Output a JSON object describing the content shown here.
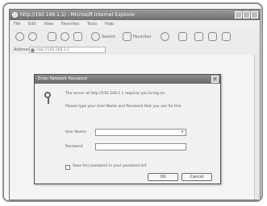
{
  "browser": {
    "title": "http://192.168.1.1/ - Microsoft Internet Explorer",
    "menu": [
      "File",
      "Edit",
      "View",
      "Favorites",
      "Tools",
      "Help"
    ],
    "toolbar": {
      "search_label": "Search",
      "favorites_label": "Favorites"
    },
    "address": {
      "label": "Address",
      "value": "http://192.168.1.1"
    }
  },
  "dialog": {
    "title": "Enter Network Password",
    "prompt": "The server at http://192.168.1.1 requires you to log on.",
    "instruction": "Please type your User Name and Password that you use for this.",
    "username_label": "User Name:",
    "username_value": "",
    "password_label": "Password:",
    "password_value": "",
    "remember_label": "Save this password in your password list",
    "ok_label": "OK",
    "cancel_label": "Cancel",
    "close_glyph": "×",
    "dropdown_glyph": "▾"
  }
}
